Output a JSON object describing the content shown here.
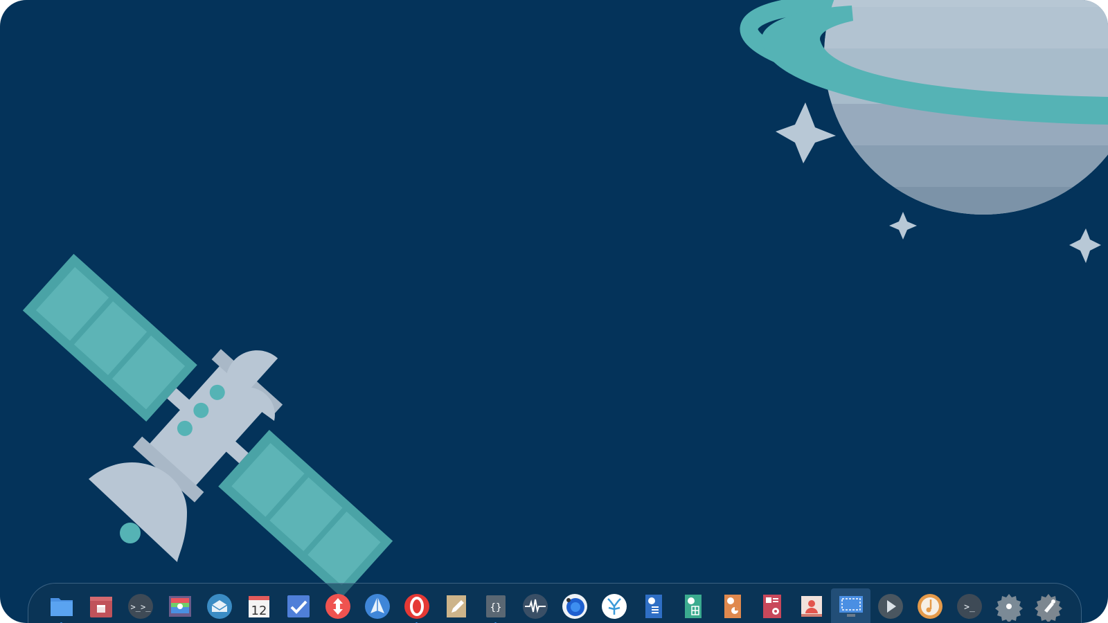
{
  "colors": {
    "wallpaper_bg": "#04335a",
    "teal": "#55b3b5",
    "panel_teal": "#4aa3a6",
    "metal": "#b8c6d4",
    "star": "#b8c8d6",
    "running_indicator": "#3fa0ff"
  },
  "calendar": {
    "day": "12"
  },
  "dock": {
    "items": [
      {
        "icon": "folder-icon",
        "app": "files",
        "running": true
      },
      {
        "icon": "store-icon",
        "app": "app-center",
        "running": false
      },
      {
        "icon": "terminal-icon",
        "app": "terminal",
        "running": false
      },
      {
        "icon": "photo-viewer-icon",
        "app": "image-viewer",
        "running": false
      },
      {
        "icon": "mail-icon",
        "app": "mail",
        "running": false
      },
      {
        "icon": "calendar-icon",
        "app": "calendar",
        "running": false
      },
      {
        "icon": "checkmark-icon",
        "app": "todo",
        "running": false
      },
      {
        "icon": "updown-icon",
        "app": "transfer",
        "running": false
      },
      {
        "icon": "paper-plane-icon",
        "app": "telegram",
        "running": false
      },
      {
        "icon": "opera-icon",
        "app": "opera",
        "running": true
      },
      {
        "icon": "pencil-icon",
        "app": "text-editor",
        "running": false
      },
      {
        "icon": "braces-icon",
        "app": "code-editor",
        "running": true
      },
      {
        "icon": "waveform-icon",
        "app": "audio-recorder",
        "running": false
      },
      {
        "icon": "camera-icon",
        "app": "camera",
        "running": false
      },
      {
        "icon": "coral-icon",
        "app": "coral",
        "running": false
      },
      {
        "icon": "document-w-icon",
        "app": "writer",
        "running": false
      },
      {
        "icon": "spreadsheet-icon",
        "app": "spreadsheet",
        "running": false
      },
      {
        "icon": "presentation-icon",
        "app": "presentation",
        "running": false
      },
      {
        "icon": "document-viewer-icon",
        "app": "document-viewer",
        "running": false
      },
      {
        "icon": "contact-icon",
        "app": "contacts",
        "running": false
      },
      {
        "icon": "screenshot-icon",
        "app": "screenshot",
        "running": false,
        "highlighted": true
      },
      {
        "icon": "play-icon",
        "app": "video-player",
        "running": false
      },
      {
        "icon": "music-icon",
        "app": "music",
        "running": false
      },
      {
        "icon": "shell-icon",
        "app": "shell",
        "running": false
      },
      {
        "icon": "gear-icon",
        "app": "settings",
        "running": false
      },
      {
        "icon": "gimp-icon",
        "app": "gimp",
        "running": false
      }
    ]
  }
}
